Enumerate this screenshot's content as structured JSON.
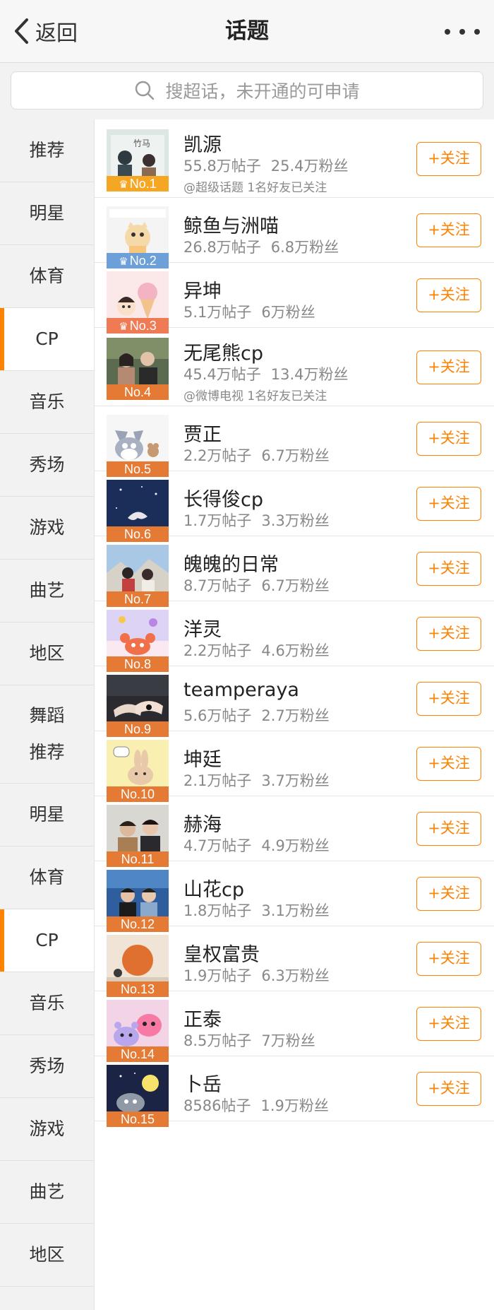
{
  "header": {
    "back_label": "返回",
    "title": "话题"
  },
  "search": {
    "placeholder": "搜超话，未开通的可申请"
  },
  "sidebar": {
    "items": [
      {
        "label": "推荐",
        "active": false
      },
      {
        "label": "明星",
        "active": false
      },
      {
        "label": "体育",
        "active": false
      },
      {
        "label": "CP",
        "active": true
      },
      {
        "label": "音乐",
        "active": false
      },
      {
        "label": "秀场",
        "active": false
      },
      {
        "label": "游戏",
        "active": false
      },
      {
        "label": "曲艺",
        "active": false
      },
      {
        "label": "地区",
        "active": false
      },
      {
        "label": "舞蹈推荐",
        "active": false
      },
      {
        "label": "明星",
        "active": false
      },
      {
        "label": "体育",
        "active": false
      },
      {
        "label": "CP",
        "active": true
      },
      {
        "label": "音乐",
        "active": false
      },
      {
        "label": "秀场",
        "active": false
      },
      {
        "label": "游戏",
        "active": false
      },
      {
        "label": "曲艺",
        "active": false
      },
      {
        "label": "地区",
        "active": false
      }
    ]
  },
  "colors": {
    "accent": "#ff8200",
    "rank_gold": "#f5a623",
    "rank_blue": "#6d9fd8",
    "rank_bronze": "#f07a54",
    "rank_default": "#e57a35"
  },
  "topics": [
    {
      "rank": "No.1",
      "name": "凯源",
      "posts": "55.8万帖子",
      "fans": "25.4万粉丝",
      "extra": "@超级话题 1名好友已关注",
      "follow": "+关注",
      "crown": true
    },
    {
      "rank": "No.2",
      "name": "鲸鱼与洲喵",
      "posts": "26.8万帖子",
      "fans": "6.8万粉丝",
      "extra": "",
      "follow": "+关注",
      "crown": true
    },
    {
      "rank": "No.3",
      "name": "异坤",
      "posts": "5.1万帖子",
      "fans": "6万粉丝",
      "extra": "",
      "follow": "+关注",
      "crown": true
    },
    {
      "rank": "No.4",
      "name": "无尾熊cp",
      "posts": "45.4万帖子",
      "fans": "13.4万粉丝",
      "extra": "@微博电视 1名好友已关注",
      "follow": "+关注",
      "crown": false
    },
    {
      "rank": "No.5",
      "name": "贾正",
      "posts": "2.2万帖子",
      "fans": "6.7万粉丝",
      "extra": "",
      "follow": "+关注",
      "crown": false
    },
    {
      "rank": "No.6",
      "name": "长得俊cp",
      "posts": "1.7万帖子",
      "fans": "3.3万粉丝",
      "extra": "",
      "follow": "+关注",
      "crown": false
    },
    {
      "rank": "No.7",
      "name": "魄魄的日常",
      "posts": "8.7万帖子",
      "fans": "6.7万粉丝",
      "extra": "",
      "follow": "+关注",
      "crown": false
    },
    {
      "rank": "No.8",
      "name": "洋灵",
      "posts": "2.2万帖子",
      "fans": "4.6万粉丝",
      "extra": "",
      "follow": "+关注",
      "crown": false
    },
    {
      "rank": "No.9",
      "name": "teamperaya",
      "posts": "5.6万帖子",
      "fans": "2.7万粉丝",
      "extra": "",
      "follow": "+关注",
      "crown": false
    },
    {
      "rank": "No.10",
      "name": "坤廷",
      "posts": "2.1万帖子",
      "fans": "3.7万粉丝",
      "extra": "",
      "follow": "+关注",
      "crown": false
    },
    {
      "rank": "No.11",
      "name": "赫海",
      "posts": "4.7万帖子",
      "fans": "4.9万粉丝",
      "extra": "",
      "follow": "+关注",
      "crown": false
    },
    {
      "rank": "No.12",
      "name": "山花cp",
      "posts": "1.8万帖子",
      "fans": "3.1万粉丝",
      "extra": "",
      "follow": "+关注",
      "crown": false
    },
    {
      "rank": "No.13",
      "name": "皇权富贵",
      "posts": "1.9万帖子",
      "fans": "6.3万粉丝",
      "extra": "",
      "follow": "+关注",
      "crown": false
    },
    {
      "rank": "No.14",
      "name": "正泰",
      "posts": "8.5万帖子",
      "fans": "7万粉丝",
      "extra": "",
      "follow": "+关注",
      "crown": false
    },
    {
      "rank": "No.15",
      "name": "卜岳",
      "posts": "8586帖子",
      "fans": "1.9万粉丝",
      "extra": "",
      "follow": "+关注",
      "crown": false
    }
  ]
}
